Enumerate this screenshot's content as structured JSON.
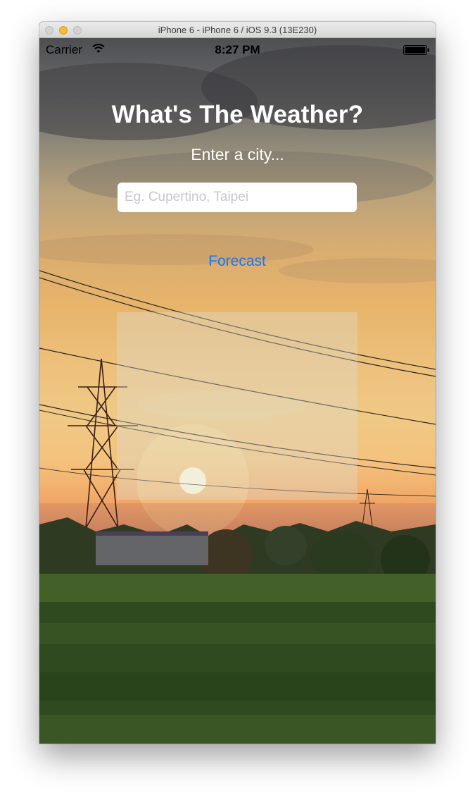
{
  "window": {
    "title": "iPhone 6 - iPhone 6 / iOS 9.3 (13E230)"
  },
  "statusbar": {
    "carrier": "Carrier",
    "time": "8:27 PM",
    "icons": [
      "wifi-icon",
      "battery-icon"
    ]
  },
  "app": {
    "title": "What's The Weather?",
    "subtitle": "Enter a city...",
    "city_input": {
      "value": "",
      "placeholder": "Eg. Cupertino, Taipei"
    },
    "forecast_button": "Forecast",
    "result": {
      "text": ""
    }
  },
  "colors": {
    "accent": "#1877f2",
    "text_light": "#ffffff",
    "placeholder": "#c7c7cd"
  }
}
